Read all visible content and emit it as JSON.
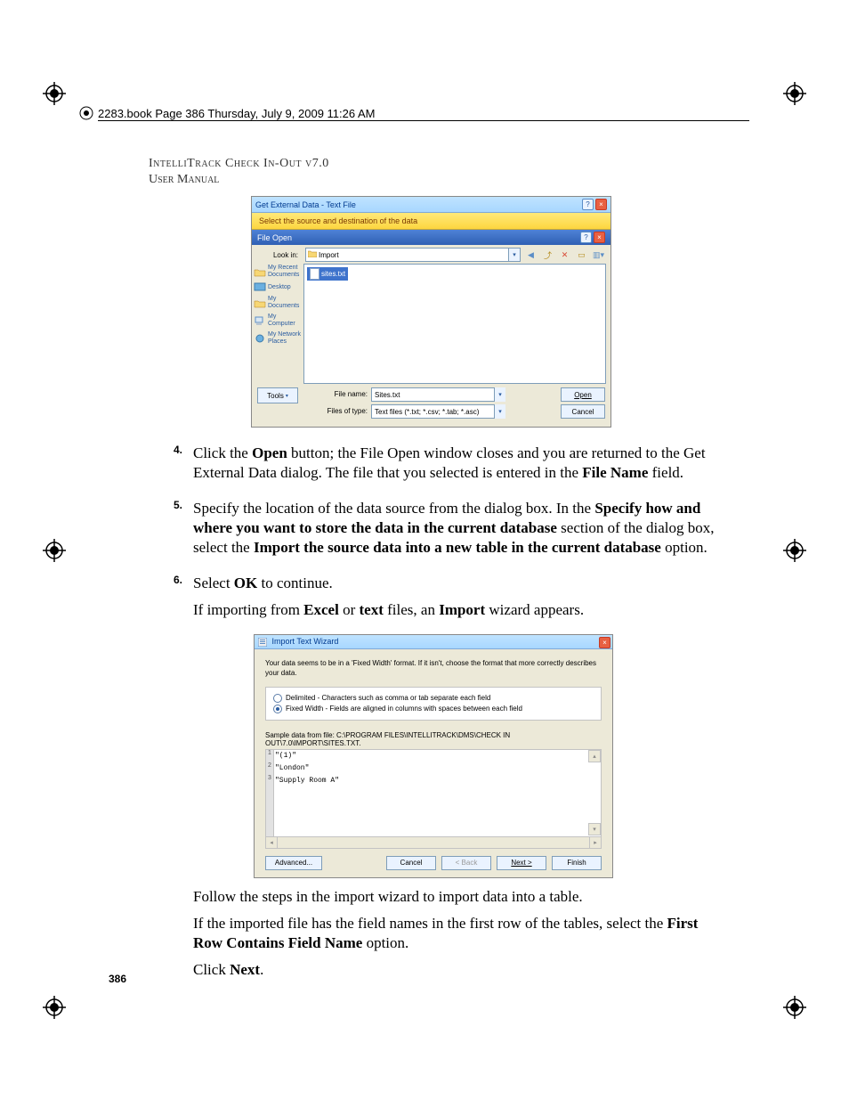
{
  "printmark": "2283.book  Page 386  Thursday, July 9, 2009  11:26 AM",
  "runninghead_line1": "IntelliTrack Check In-Out v7.0",
  "runninghead_line2": "User Manual",
  "page_number": "386",
  "fig1": {
    "window_title": "Get External Data - Text File",
    "wizard_subtitle": "Select the source and destination of the data",
    "fileopen_title": "File Open",
    "lookin_label": "Look in:",
    "folder": "Import",
    "places": [
      {
        "label": "My Recent Documents"
      },
      {
        "label": "Desktop"
      },
      {
        "label": "My Documents"
      },
      {
        "label": "My Computer"
      },
      {
        "label": "My Network Places"
      }
    ],
    "file": "sites.txt",
    "filename_label": "File name:",
    "filename_value": "Sites.txt",
    "filetype_label": "Files of type:",
    "filetype_value": "Text files (*.txt; *.csv; *.tab; *.asc)",
    "tools": "Tools",
    "open": "Open",
    "cancel": "Cancel"
  },
  "step4": {
    "num": "4.",
    "p1a": "Click the ",
    "p1b": "Open",
    "p1c": " button; the File Open window closes and you are returned to the Get External Data dialog. The file that you selected is entered in the ",
    "p1d": "File Name",
    "p1e": " field."
  },
  "step5": {
    "num": "5.",
    "p1": "Specify the location of the data source from the dialog box. In the ",
    "p2": "Specify how and where you want to store the data in the current database",
    "p3": " section of the dialog box, select the ",
    "p4": "Import the source data into a new table in the current database",
    "p5": " option."
  },
  "step6": {
    "num": "6.",
    "l1a": "Select ",
    "l1b": "OK",
    "l1c": " to continue.",
    "l2a": "If importing from ",
    "l2b": "Excel",
    "l2c": " or ",
    "l2d": "text",
    "l2e": " files, an ",
    "l2f": "Import",
    "l2g": " wizard appears."
  },
  "fig2": {
    "title": "Import Text Wizard",
    "intro": "Your data seems to be in a 'Fixed Width' format. If it isn't, choose the format that more correctly describes your data.",
    "delimited_label": "Delimited - Characters such as comma or tab separate each field",
    "fixed_label": "Fixed Width - Fields are aligned in columns with spaces between each field",
    "sample_label": "Sample data from file: C:\\PROGRAM FILES\\INTELLITRACK\\DMS\\CHECK IN OUT\\7.0\\IMPORT\\SITES.TXT.",
    "rows": [
      "\"(1)\"",
      "\"London\"",
      "\"Supply Room A\""
    ],
    "advanced": "Advanced...",
    "cancel": "Cancel",
    "back": "< Back",
    "next": "Next >",
    "finish": "Finish"
  },
  "follow": {
    "p1": "Follow the steps in the import wizard to import data into a table.",
    "p2a": "If the imported file has the field names in the first row of the tables, select the ",
    "p2b": "First Row Contains Field Name",
    "p2c": " option.",
    "p3a": "Click ",
    "p3b": "Next",
    "p3c": "."
  }
}
